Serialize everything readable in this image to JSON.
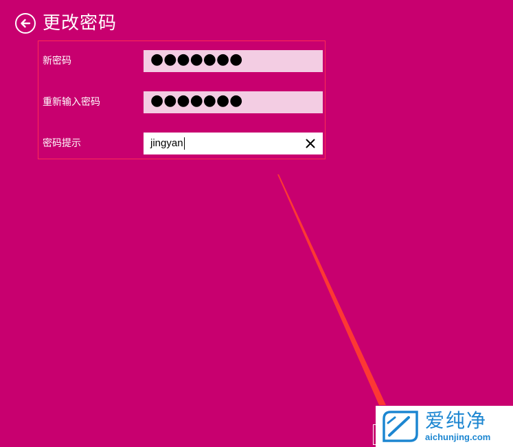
{
  "header": {
    "title": "更改密码",
    "back_icon": "arrow-left-circle-icon"
  },
  "form": {
    "new_password": {
      "label": "新密码",
      "masked_value": "●●●●●●●"
    },
    "confirm_password": {
      "label": "重新输入密码",
      "masked_value": "●●●●●●●"
    },
    "password_hint": {
      "label": "密码提示",
      "value": "jingyan",
      "clear_icon": "close-icon"
    }
  },
  "watermark": {
    "name": "爱纯净",
    "url": "aichunjing.com"
  },
  "colors": {
    "background": "#c8006f",
    "form_border": "#ff2d55",
    "field_inactive": "#f3cde3",
    "field_active": "#ffffff",
    "pointer_line": "#ff3b30",
    "watermark_blue": "#1c86d1"
  }
}
